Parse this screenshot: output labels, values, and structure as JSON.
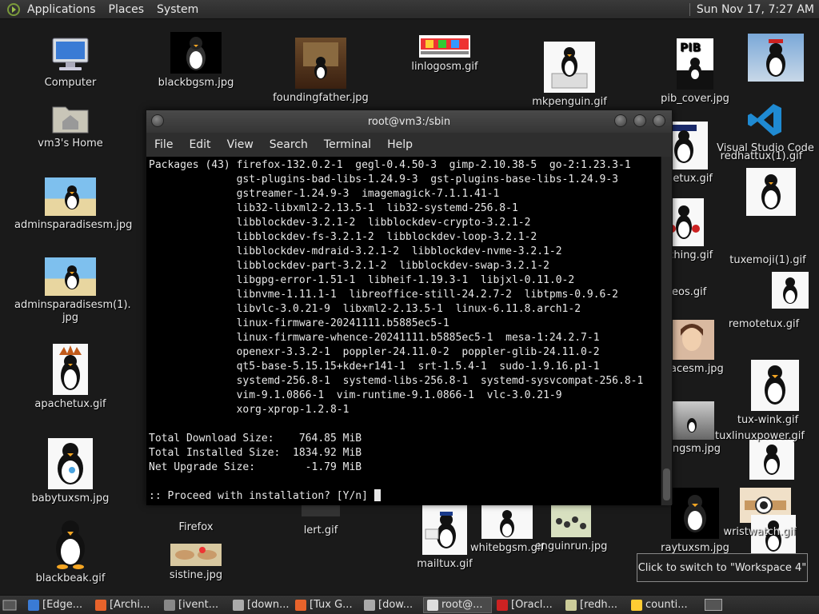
{
  "top_panel": {
    "menus": [
      "Applications",
      "Places",
      "System"
    ],
    "clock": "Sun Nov 17,  7:27 AM"
  },
  "desktop_icons": [
    {
      "label": "Computer",
      "icon": "computer-icon"
    },
    {
      "label": "vm3's Home",
      "icon": "home-folder-icon"
    },
    {
      "label": "adminsparadisesm.jpg",
      "icon": "image-thumbnail"
    },
    {
      "label": "adminsparadisesm(1).\njpg",
      "icon": "image-thumbnail"
    },
    {
      "label": "apachetux.gif",
      "icon": "image-thumbnail"
    },
    {
      "label": "babytuxsm.jpg",
      "icon": "image-thumbnail"
    },
    {
      "label": "blackbeak.gif",
      "icon": "image-thumbnail"
    },
    {
      "label": "blackbgsm.jpg",
      "icon": "image-thumbnail"
    },
    {
      "label": "foundingfather.jpg",
      "icon": "image-thumbnail"
    },
    {
      "label": "linlogosm.gif",
      "icon": "image-thumbnail"
    },
    {
      "label": "mkpenguin.gif",
      "icon": "image-thumbnail"
    },
    {
      "label": "pib_cover.jpg",
      "icon": "image-thumbnail"
    },
    {
      "label": "Firefox",
      "icon": "firefox-icon"
    },
    {
      "label": "sistine.jpg",
      "icon": "image-thumbnail"
    },
    {
      "label": "lert.gif",
      "icon": "image-thumbnail"
    },
    {
      "label": "mailtux.gif",
      "icon": "image-thumbnail"
    },
    {
      "label": "whitebgsm.gif",
      "icon": "image-thumbnail"
    },
    {
      "label": "enguinrun.jpg",
      "icon": "image-thumbnail"
    },
    {
      "label": "raytuxsm.jpg",
      "icon": "image-thumbnail"
    },
    {
      "label": "olicetux.gif",
      "icon": "image-thumbnail"
    },
    {
      "label": "unching.gif",
      "icon": "image-thumbnail"
    },
    {
      "label": "ureos.gif",
      "icon": "image-thumbnail"
    },
    {
      "label": "pfacesm.jpg",
      "icon": "image-thumbnail"
    },
    {
      "label": "ningsm.jpg",
      "icon": "image-thumbnail"
    },
    {
      "label": "Visual Studio Code",
      "icon": "vscode-icon"
    },
    {
      "label": "redhattux(1).gif",
      "icon": "image-thumbnail"
    },
    {
      "label": "tuxemoji(1).gif",
      "icon": "image-thumbnail"
    },
    {
      "label": "remotetux.gif",
      "icon": "image-thumbnail"
    },
    {
      "label": "tux-wink.gif",
      "icon": "image-thumbnail"
    },
    {
      "label": "tuxlinuxpower.gif",
      "icon": "image-thumbnail"
    },
    {
      "label": "wristwatch.gif",
      "icon": "image-thumbnail"
    }
  ],
  "terminal": {
    "title": "root@vm3:/sbin",
    "menu": [
      "File",
      "Edit",
      "View",
      "Search",
      "Terminal",
      "Help"
    ],
    "lines": [
      "Packages (43) firefox-132.0.2-1  gegl-0.4.50-3  gimp-2.10.38-5  go-2:1.23.3-1",
      "              gst-plugins-bad-libs-1.24.9-3  gst-plugins-base-libs-1.24.9-3",
      "              gstreamer-1.24.9-3  imagemagick-7.1.1.41-1",
      "              lib32-libxml2-2.13.5-1  lib32-systemd-256.8-1",
      "              libblockdev-3.2.1-2  libblockdev-crypto-3.2.1-2",
      "              libblockdev-fs-3.2.1-2  libblockdev-loop-3.2.1-2",
      "              libblockdev-mdraid-3.2.1-2  libblockdev-nvme-3.2.1-2",
      "              libblockdev-part-3.2.1-2  libblockdev-swap-3.2.1-2",
      "              libgpg-error-1.51-1  libheif-1.19.3-1  libjxl-0.11.0-2",
      "              libnvme-1.11.1-1  libreoffice-still-24.2.7-2  libtpms-0.9.6-2",
      "              libvlc-3.0.21-9  libxml2-2.13.5-1  linux-6.11.8.arch1-2",
      "              linux-firmware-20241111.b5885ec5-1",
      "              linux-firmware-whence-20241111.b5885ec5-1  mesa-1:24.2.7-1",
      "              openexr-3.3.2-1  poppler-24.11.0-2  poppler-glib-24.11.0-2",
      "              qt5-base-5.15.15+kde+r141-1  srt-1.5.4-1  sudo-1.9.16.p1-1",
      "              systemd-256.8-1  systemd-libs-256.8-1  systemd-sysvcompat-256.8-1",
      "              vim-9.1.0866-1  vim-runtime-9.1.0866-1  vlc-3.0.21-9",
      "              xorg-xprop-1.2.8-1",
      "",
      "Total Download Size:    764.85 MiB",
      "Total Installed Size:  1834.92 MiB",
      "Net Upgrade Size:        -1.79 MiB",
      ""
    ],
    "prompt": ":: Proceed with installation? [Y/n] "
  },
  "tooltip": "Click to switch to \"Workspace 4\"",
  "taskbar": {
    "tasks": [
      "[Edge...",
      "[Archi...",
      "[ivent...",
      "[down...",
      "[Tux G...",
      "[dow...",
      "root@...",
      "[Oracl...",
      "[redh...",
      "counti..."
    ]
  }
}
